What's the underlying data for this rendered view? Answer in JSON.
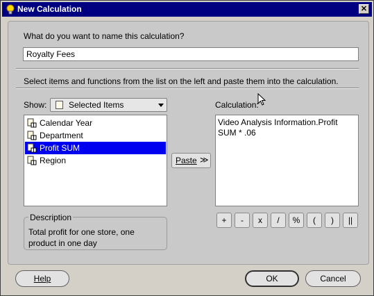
{
  "window": {
    "title": "New Calculation",
    "title_icon": "lightbulb-icon",
    "close_label": "✕"
  },
  "name_section": {
    "prompt": "What do you want to name this calculation?",
    "value": "Royalty Fees"
  },
  "instruction": "Select items and functions from the list on the left and paste them into the calculation.",
  "show": {
    "label": "Show:",
    "selected": "Selected Items"
  },
  "items": [
    {
      "label": "Calendar Year",
      "icon": "item-icon",
      "selected": false
    },
    {
      "label": "Department",
      "icon": "item-icon",
      "selected": false
    },
    {
      "label": "Profit SUM",
      "icon": "item-icon",
      "selected": true
    },
    {
      "label": "Region",
      "icon": "item-icon",
      "selected": false
    }
  ],
  "paste": {
    "label": "Paste",
    "arrow": "≫"
  },
  "calculation": {
    "label": "Calculation:",
    "text": "Video Analysis Information.Profit\nSUM * .06"
  },
  "operators": [
    "+",
    "-",
    "x",
    "/",
    "%",
    "(",
    ")",
    "||"
  ],
  "description": {
    "legend": "Description",
    "text": "Total profit for one store, one product in one day"
  },
  "buttons": {
    "help": "Help",
    "ok": "OK",
    "cancel": "Cancel"
  },
  "colors": {
    "titlebar": "#000080",
    "selection": "#0000f0"
  }
}
